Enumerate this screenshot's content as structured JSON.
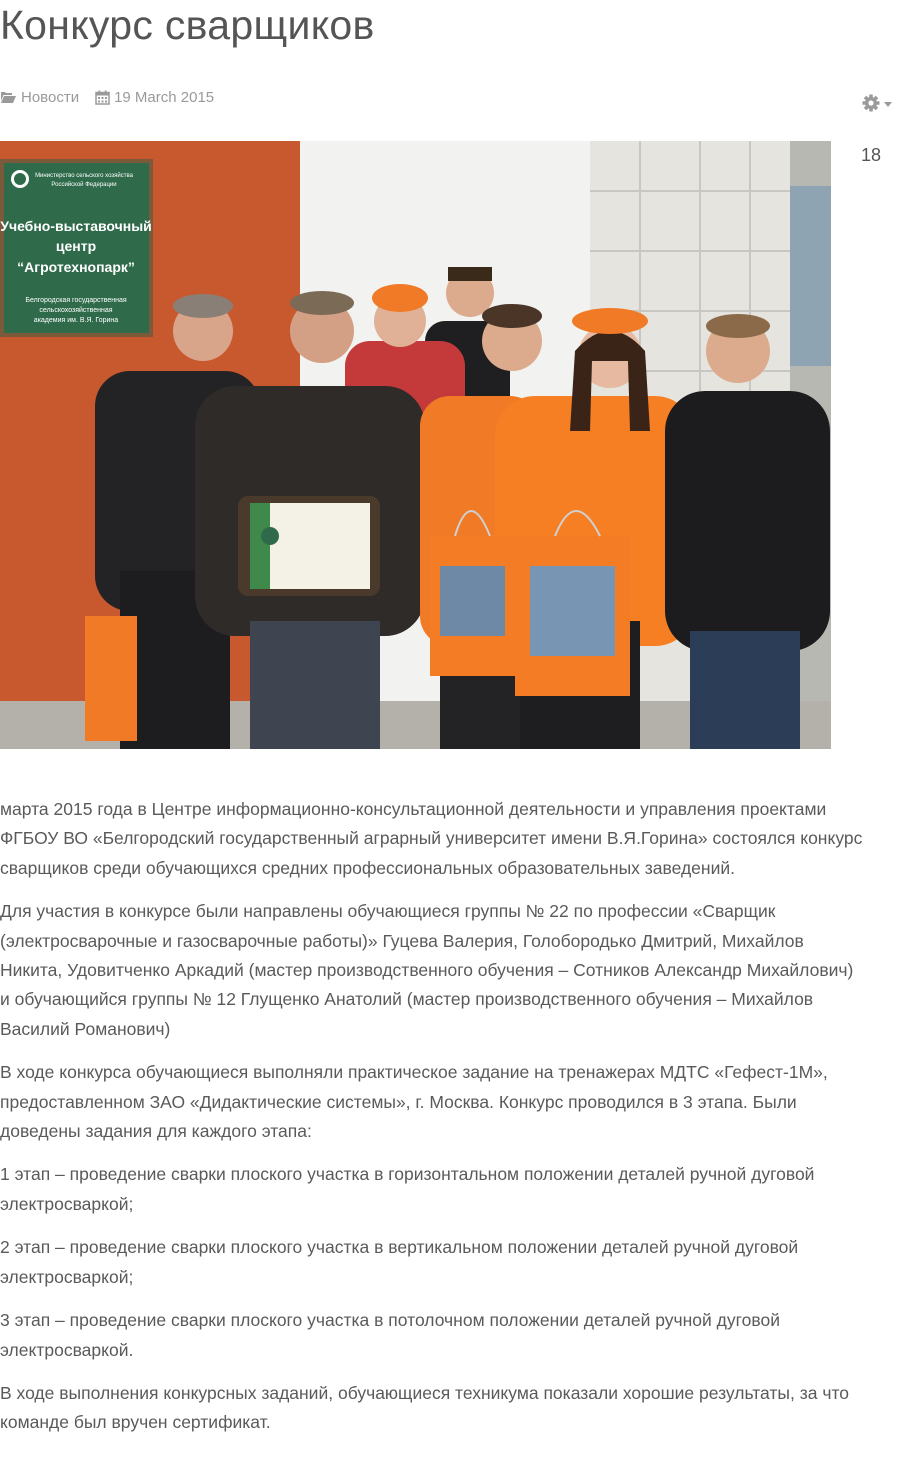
{
  "article": {
    "title": "Конкурс сварщиков",
    "category": "Новости",
    "date": "19 March 2015",
    "day_prefix": "18"
  },
  "icons": {
    "category": "folder-open-icon",
    "date": "calendar-icon",
    "settings": "gear-icon"
  },
  "photo": {
    "sign_lines": [
      "Министерство сельского хозяйства",
      "Российской Федерации",
      "Учебно-выставочный",
      "центр",
      "“Агротехнопарк”",
      "Белгородская государственная",
      "сельскохозяйственная",
      "академия им. В.Я. Горина"
    ]
  },
  "colors": {
    "text": "#555555",
    "meta": "#9a9a9a",
    "wall": "#c8582e",
    "shirt": "#f07a25"
  },
  "paragraphs": [
    [
      "марта 2015 года  в Центре информационно-консультационной деятельности и управления проектами",
      "ФГБОУ ВО «Белгородский государственный аграрный университет имени В.Я.Горина» состоялся конкурс",
      "сварщиков среди обучающихся средних профессиональных образовательных заведений."
    ],
    [
      "Для участия в конкурсе были направлены обучающиеся группы № 22 по профессии «Сварщик",
      "(электросварочные и  газосварочные работы)»  Гуцева Валерия,  Голобородько Дмитрий, Михайлов",
      "Никита, Удовитченко Аркадий  (мастер производственного обучения – Сотников Александр Михайлович)",
      "и обучающийся группы № 12 Глущенко Анатолий (мастер производственного обучения – Михайлов",
      "Василий Романович)"
    ],
    [
      "В ходе конкурса обучающиеся выполняли практическое задание на тренажерах МДТС «Гефест-1М»,",
      "предоставленном ЗАО «Дидактические системы», г. Москва. Конкурс проводился в 3 этапа. Были",
      "доведены задания для каждого этапа:"
    ],
    [
      "1 этап – проведение сварки плоского участка в горизонтальном положении деталей ручной дуговой",
      "электросваркой;"
    ],
    [
      "2 этап –  проведение сварки плоского участка в вертикальном положении деталей ручной дуговой",
      "электросваркой;"
    ],
    [
      "3 этап – проведение сварки плоского участка в потолочном  положении деталей ручной дуговой",
      "электросваркой."
    ],
    [
      "В ходе выполнения конкурсных заданий, обучающиеся техникума показали хорошие результаты, за что",
      "команде был вручен сертификат."
    ]
  ]
}
